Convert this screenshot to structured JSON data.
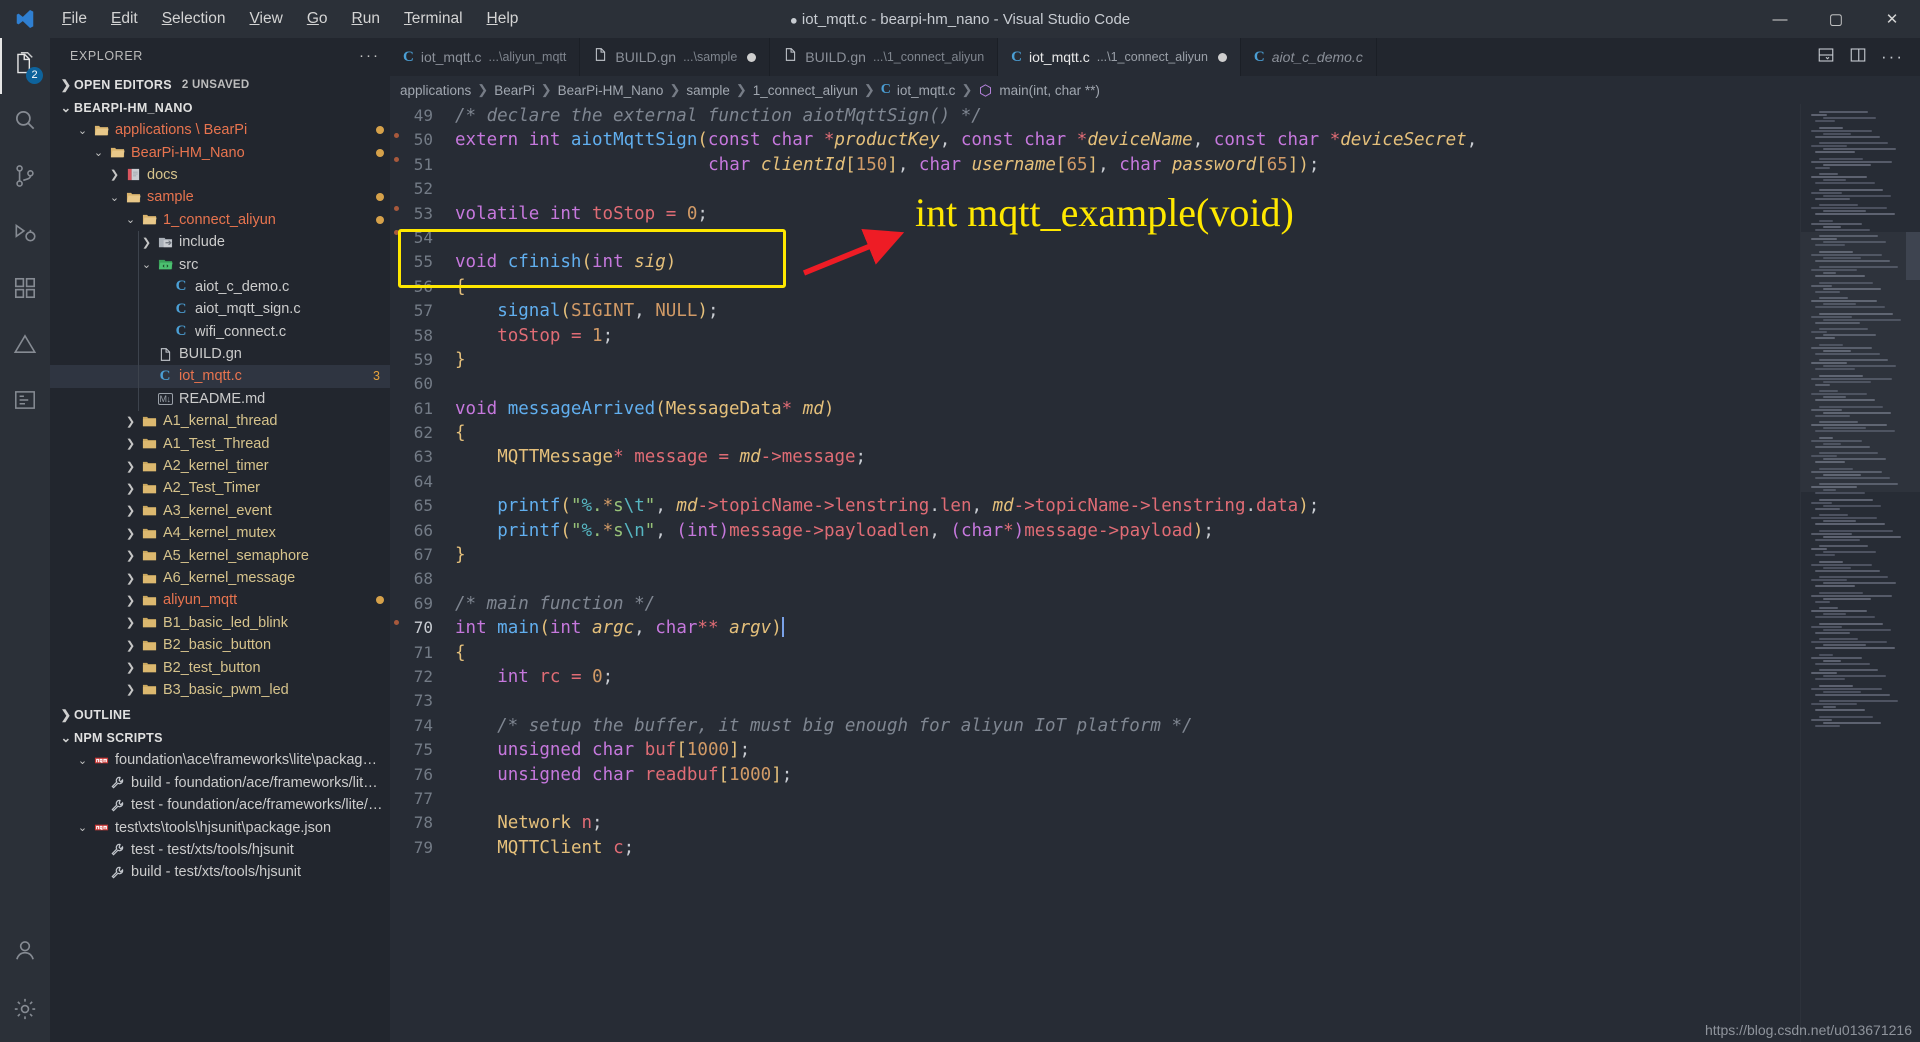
{
  "window": {
    "title": "iot_mqtt.c - bearpi-hm_nano - Visual Studio Code",
    "dirty_marker": "●",
    "minimize": "—",
    "maximize": "▢",
    "close": "✕"
  },
  "menubar": [
    {
      "label": "File"
    },
    {
      "label": "Edit"
    },
    {
      "label": "Selection"
    },
    {
      "label": "View"
    },
    {
      "label": "Go"
    },
    {
      "label": "Run"
    },
    {
      "label": "Terminal"
    },
    {
      "label": "Help"
    }
  ],
  "activitybar": {
    "items": [
      {
        "name": "explorer",
        "icon": "files-icon",
        "badge": "2",
        "active": true
      },
      {
        "name": "search",
        "icon": "search-icon",
        "badge": ""
      },
      {
        "name": "source-control",
        "icon": "source-control-icon",
        "badge": ""
      },
      {
        "name": "run-and-debug",
        "icon": "debug-icon",
        "badge": ""
      },
      {
        "name": "extensions",
        "icon": "extensions-icon",
        "badge": ""
      },
      {
        "name": "deveco",
        "icon": "triangle-icon",
        "badge": ""
      },
      {
        "name": "remote",
        "icon": "remote-icon",
        "badge": ""
      }
    ],
    "bottom": [
      {
        "name": "accounts",
        "icon": "account-icon"
      },
      {
        "name": "settings",
        "icon": "gear-icon"
      }
    ]
  },
  "sidebar": {
    "header_title": "EXPLORER",
    "header_more": "···",
    "open_editors": {
      "label": "OPEN EDITORS",
      "sub": "2 UNSAVED",
      "expanded": false
    },
    "workspace": {
      "label": "BEARPI-HM_NANO",
      "expanded": true
    },
    "tree": [
      {
        "label": "applications \\ BearPi",
        "indent": 1,
        "type": "folder-open",
        "color": "orange",
        "twist": "down",
        "dirty": true
      },
      {
        "label": "BearPi-HM_Nano",
        "indent": 2,
        "type": "folder-open",
        "color": "orange",
        "twist": "down",
        "dirty": true
      },
      {
        "label": "docs",
        "indent": 3,
        "type": "folder-docs",
        "color": "tan",
        "twist": "right"
      },
      {
        "label": "sample",
        "indent": 3,
        "type": "folder-open",
        "color": "orange",
        "twist": "down",
        "dirty": true
      },
      {
        "label": "1_connect_aliyun",
        "indent": 4,
        "type": "folder-open",
        "color": "orange",
        "twist": "down",
        "dirty": true
      },
      {
        "label": "include",
        "indent": 5,
        "type": "folder-include",
        "color": "normal",
        "twist": "right"
      },
      {
        "label": "src",
        "indent": 5,
        "type": "folder-src",
        "color": "normal",
        "twist": "down"
      },
      {
        "label": "aiot_c_demo.c",
        "indent": 6,
        "type": "c-file",
        "color": "normal",
        "twist": "none"
      },
      {
        "label": "aiot_mqtt_sign.c",
        "indent": 6,
        "type": "c-file",
        "color": "normal",
        "twist": "none"
      },
      {
        "label": "wifi_connect.c",
        "indent": 6,
        "type": "c-file",
        "color": "normal",
        "twist": "none"
      },
      {
        "label": "BUILD.gn",
        "indent": 5,
        "type": "plain-file",
        "color": "normal",
        "twist": "none"
      },
      {
        "label": "iot_mqtt.c",
        "indent": 5,
        "type": "c-file",
        "color": "orange",
        "twist": "none",
        "selected": true,
        "badge": "3"
      },
      {
        "label": "README.md",
        "indent": 5,
        "type": "md-file",
        "color": "normal",
        "twist": "none"
      },
      {
        "label": "A1_kernal_thread",
        "indent": 4,
        "type": "folder",
        "color": "tan",
        "twist": "right"
      },
      {
        "label": "A1_Test_Thread",
        "indent": 4,
        "type": "folder",
        "color": "tan",
        "twist": "right"
      },
      {
        "label": "A2_kernel_timer",
        "indent": 4,
        "type": "folder",
        "color": "tan",
        "twist": "right"
      },
      {
        "label": "A2_Test_Timer",
        "indent": 4,
        "type": "folder",
        "color": "tan",
        "twist": "right"
      },
      {
        "label": "A3_kernel_event",
        "indent": 4,
        "type": "folder",
        "color": "tan",
        "twist": "right"
      },
      {
        "label": "A4_kernel_mutex",
        "indent": 4,
        "type": "folder",
        "color": "tan",
        "twist": "right"
      },
      {
        "label": "A5_kernel_semaphore",
        "indent": 4,
        "type": "folder",
        "color": "tan",
        "twist": "right"
      },
      {
        "label": "A6_kernel_message",
        "indent": 4,
        "type": "folder",
        "color": "tan",
        "twist": "right"
      },
      {
        "label": "aliyun_mqtt",
        "indent": 4,
        "type": "folder",
        "color": "orange",
        "twist": "right",
        "dirty": true
      },
      {
        "label": "B1_basic_led_blink",
        "indent": 4,
        "type": "folder",
        "color": "tan",
        "twist": "right"
      },
      {
        "label": "B2_basic_button",
        "indent": 4,
        "type": "folder",
        "color": "tan",
        "twist": "right"
      },
      {
        "label": "B2_test_button",
        "indent": 4,
        "type": "folder",
        "color": "tan",
        "twist": "right"
      },
      {
        "label": "B3_basic_pwm_led",
        "indent": 4,
        "type": "folder",
        "color": "tan",
        "twist": "right"
      }
    ],
    "outline": {
      "label": "OUTLINE",
      "expanded": false
    },
    "npm_scripts": {
      "label": "NPM SCRIPTS",
      "expanded": true,
      "items": [
        {
          "label": "foundation\\ace\\frameworks\\lite\\packages\\r...",
          "indent": 1,
          "type": "npm",
          "twist": "down"
        },
        {
          "label": "build - foundation/ace/frameworks/lite/pa...",
          "indent": 2,
          "type": "script",
          "twist": "none"
        },
        {
          "label": "test - foundation/ace/frameworks/lite/pack...",
          "indent": 2,
          "type": "script",
          "twist": "none"
        },
        {
          "label": "test\\xts\\tools\\hjsunit\\package.json",
          "indent": 1,
          "type": "npm",
          "twist": "down"
        },
        {
          "label": "test - test/xts/tools/hjsunit",
          "indent": 2,
          "type": "script",
          "twist": "none"
        },
        {
          "label": "build - test/xts/tools/hjsunit",
          "indent": 2,
          "type": "script",
          "twist": "none"
        }
      ]
    }
  },
  "tabs": [
    {
      "name": "iot_mqtt.c",
      "path": "...\\aliyun_mqtt",
      "icon": "c-file-icon",
      "active": false,
      "dirty": false,
      "italic": false
    },
    {
      "name": "BUILD.gn",
      "path": "...\\sample",
      "icon": "plain-file-icon",
      "active": false,
      "dirty": true,
      "italic": false
    },
    {
      "name": "BUILD.gn",
      "path": "...\\1_connect_aliyun",
      "icon": "plain-file-icon",
      "active": false,
      "dirty": false,
      "italic": false
    },
    {
      "name": "iot_mqtt.c",
      "path": "...\\1_connect_aliyun",
      "icon": "c-file-icon",
      "active": true,
      "dirty": true,
      "italic": false
    },
    {
      "name": "aiot_c_demo.c",
      "path": "",
      "icon": "c-file-icon",
      "active": false,
      "dirty": false,
      "italic": true
    }
  ],
  "tab_actions": [
    "split-editor-down-icon",
    "split-editor-right-icon",
    "more-actions-icon"
  ],
  "breadcrumb": [
    {
      "label": "applications",
      "icon": ""
    },
    {
      "label": "BearPi",
      "icon": ""
    },
    {
      "label": "BearPi-HM_Nano",
      "icon": ""
    },
    {
      "label": "sample",
      "icon": ""
    },
    {
      "label": "1_connect_aliyun",
      "icon": ""
    },
    {
      "label": "iot_mqtt.c",
      "icon": "c-file-icon"
    },
    {
      "label": "main(int, char **)",
      "icon": "symbol-method-icon"
    }
  ],
  "editor": {
    "first_line": 49,
    "current_line": 70,
    "lines": [
      {
        "n": 49,
        "text": "/* declare the external function aiotMqttSign() */"
      },
      {
        "n": 50,
        "text": "extern int aiotMqttSign(const char *productKey, const char *deviceName, const char *deviceSecret,"
      },
      {
        "n": 51,
        "text": "                        char clientId[150], char username[65], char password[65]);"
      },
      {
        "n": 52,
        "text": ""
      },
      {
        "n": 53,
        "text": "volatile int toStop = 0;"
      },
      {
        "n": 54,
        "text": ""
      },
      {
        "n": 55,
        "text": "void cfinish(int sig)"
      },
      {
        "n": 56,
        "text": "{"
      },
      {
        "n": 57,
        "text": "    signal(SIGINT, NULL);"
      },
      {
        "n": 58,
        "text": "    toStop = 1;"
      },
      {
        "n": 59,
        "text": "}"
      },
      {
        "n": 60,
        "text": ""
      },
      {
        "n": 61,
        "text": "void messageArrived(MessageData* md)"
      },
      {
        "n": 62,
        "text": "{"
      },
      {
        "n": 63,
        "text": "    MQTTMessage* message = md->message;"
      },
      {
        "n": 64,
        "text": ""
      },
      {
        "n": 65,
        "text": "    printf(\"%.*s\\t\", md->topicName->lenstring.len, md->topicName->lenstring.data);"
      },
      {
        "n": 66,
        "text": "    printf(\"%.*s\\n\", (int)message->payloadlen, (char*)message->payload);"
      },
      {
        "n": 67,
        "text": "}"
      },
      {
        "n": 68,
        "text": ""
      },
      {
        "n": 69,
        "text": "/* main function */"
      },
      {
        "n": 70,
        "text": "int main(int argc, char** argv)"
      },
      {
        "n": 71,
        "text": "{"
      },
      {
        "n": 72,
        "text": "    int rc = 0;"
      },
      {
        "n": 73,
        "text": ""
      },
      {
        "n": 74,
        "text": "    /* setup the buffer, it must big enough for aliyun IoT platform */"
      },
      {
        "n": 75,
        "text": "    unsigned char buf[1000];"
      },
      {
        "n": 76,
        "text": "    unsigned char readbuf[1000];"
      },
      {
        "n": 77,
        "text": ""
      },
      {
        "n": 78,
        "text": "    Network n;"
      },
      {
        "n": 79,
        "text": "    MQTTClient c;"
      }
    ]
  },
  "annotations": {
    "box_label": "",
    "callout_text": "int   mqtt_example(void)",
    "box_color": "#ffe800",
    "arrow_color": "#ee1c25"
  },
  "watermark": "https://blog.csdn.net/u013671216"
}
